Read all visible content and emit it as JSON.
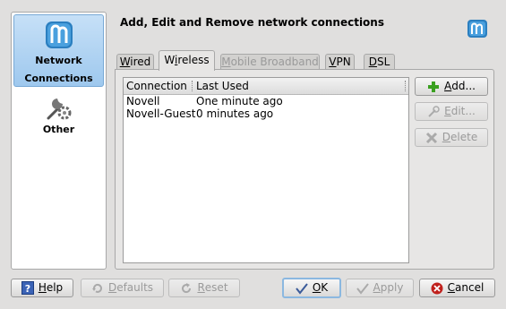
{
  "sidebar": {
    "items": [
      {
        "label_line1": "Network",
        "label_line2": "Connections",
        "icon": "network-connections-icon",
        "selected": true
      },
      {
        "label_line1": "Other",
        "icon": "wrench-gear-icon"
      }
    ]
  },
  "header": {
    "title": "Add, Edit and Remove network connections",
    "logo_icon": "network-logo-icon"
  },
  "tabs": [
    {
      "pre": "",
      "mnemonic": "W",
      "post": "ired",
      "state": "normal"
    },
    {
      "pre": "W",
      "mnemonic": "i",
      "post": "reless",
      "state": "active"
    },
    {
      "pre": "",
      "mnemonic": "M",
      "post": "obile Broadband",
      "state": "disabled"
    },
    {
      "pre": "",
      "mnemonic": "V",
      "post": "PN",
      "state": "normal"
    },
    {
      "pre": "",
      "mnemonic": "D",
      "post": "SL",
      "state": "normal"
    }
  ],
  "table": {
    "columns": [
      "Connection",
      "Last Used"
    ],
    "rows": [
      [
        "Novell",
        "One minute ago"
      ],
      [
        "Novell-Guest",
        "0 minutes ago"
      ]
    ]
  },
  "side_buttons": [
    {
      "pre": "",
      "mnemonic": "A",
      "post": "dd...",
      "icon": "plus-icon",
      "disabled": false
    },
    {
      "pre": "",
      "mnemonic": "E",
      "post": "dit...",
      "icon": "edit-icon",
      "disabled": true
    },
    {
      "pre": "",
      "mnemonic": "D",
      "post": "elete",
      "icon": "delete-icon",
      "disabled": true
    }
  ],
  "footer": {
    "help": {
      "pre": "",
      "mnemonic": "H",
      "post": "elp",
      "icon": "help-icon"
    },
    "defaults": {
      "pre": "",
      "mnemonic": "D",
      "post": "efaults",
      "icon": "defaults-icon"
    },
    "reset": {
      "pre": "",
      "mnemonic": "R",
      "post": "eset",
      "icon": "reset-icon"
    },
    "ok": {
      "pre": "",
      "mnemonic": "O",
      "post": "K",
      "icon": "check-icon"
    },
    "apply": {
      "pre": "",
      "mnemonic": "A",
      "post": "pply",
      "icon": "check-icon"
    },
    "cancel": {
      "pre": "",
      "mnemonic": "C",
      "post": "ancel",
      "icon": "cancel-icon"
    }
  },
  "colors": {
    "accent": "#5aa3dc",
    "add_green": "#3aa020",
    "cancel_red": "#c0201c"
  }
}
